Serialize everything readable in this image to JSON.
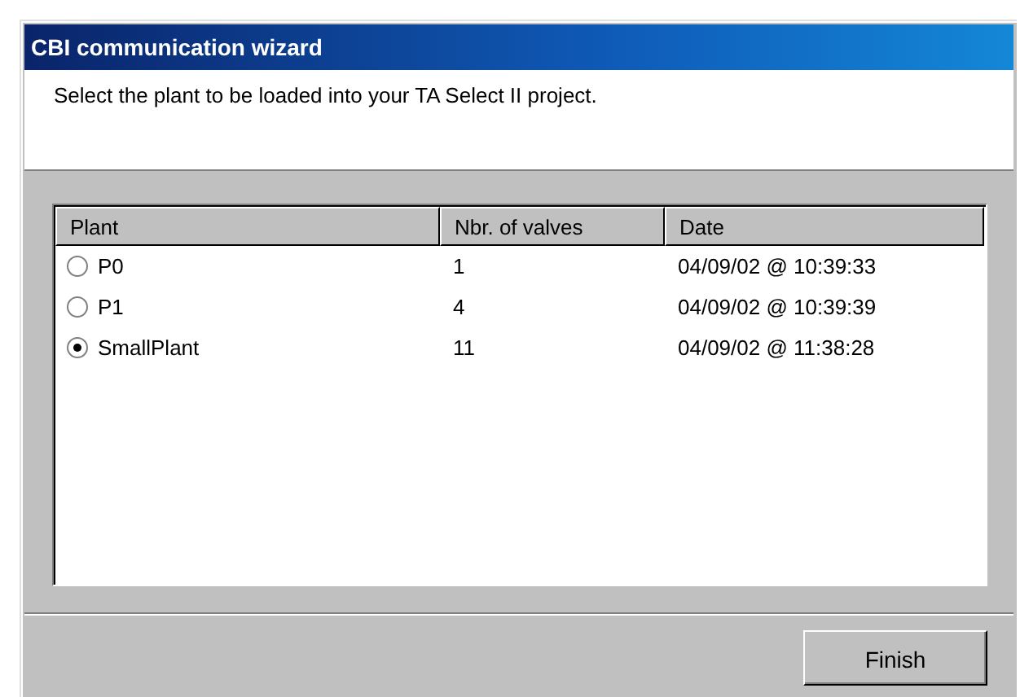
{
  "window": {
    "title": "CBI communication wizard"
  },
  "instruction": "Select the plant to be loaded into your TA Select II project.",
  "table": {
    "columns": [
      "Plant",
      "Nbr. of valves",
      "Date"
    ],
    "rows": [
      {
        "plant": "P0",
        "valves": "1",
        "date": "04/09/02 @ 10:39:33",
        "selected": false
      },
      {
        "plant": "P1",
        "valves": "4",
        "date": "04/09/02 @ 10:39:39",
        "selected": false
      },
      {
        "plant": "SmallPlant",
        "valves": "11",
        "date": "04/09/02 @ 11:38:28",
        "selected": true
      }
    ]
  },
  "buttons": [
    "Finish"
  ]
}
